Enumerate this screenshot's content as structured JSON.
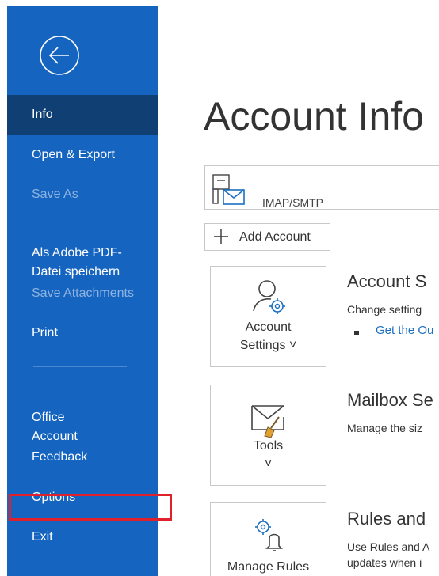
{
  "sidebar": {
    "back_label": "Back",
    "items": [
      {
        "label": "Info"
      },
      {
        "label": "Open & Export"
      },
      {
        "label": "Save As"
      },
      {
        "label": "Als Adobe PDF-\nDatei speichern"
      },
      {
        "label": "Save Attachments"
      },
      {
        "label": "Print"
      },
      {
        "label": "Office\nAccount"
      },
      {
        "label": "Feedback"
      },
      {
        "label": "Options"
      },
      {
        "label": "Exit"
      }
    ]
  },
  "main": {
    "title": "Account Info",
    "account_selector": {
      "type": "IMAP/SMTP"
    },
    "add_account_label": "Add Account",
    "sections": [
      {
        "button_label": "Account",
        "button_label_2": "Settings ˅",
        "title": "Account S",
        "description": "Change setting",
        "link": "Get the Ou"
      },
      {
        "button_label": "Tools",
        "button_label_2": "˅",
        "title": "Mailbox Se",
        "description": "Manage the siz"
      },
      {
        "button_label": "Manage Rules",
        "title": "Rules and",
        "description": "Use Rules and A",
        "description_2": "updates when i"
      }
    ]
  },
  "colors": {
    "sidebar_bg": "#1565c0",
    "selected_item_bg": "#0f3f73",
    "highlight_border": "#e0202a",
    "link": "#1a6fc2"
  }
}
